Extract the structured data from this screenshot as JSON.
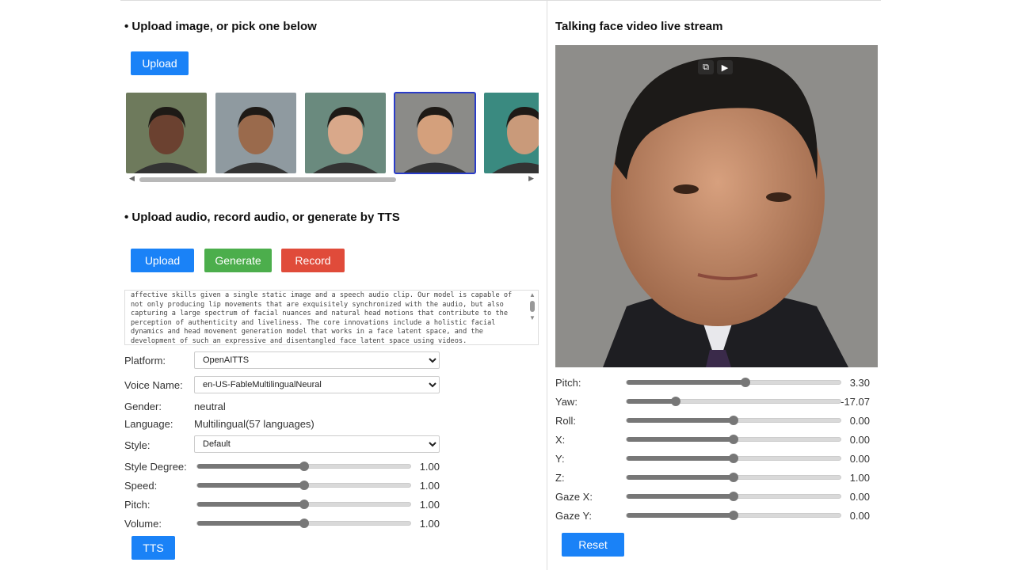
{
  "left": {
    "image_section_title": "• Upload image, or pick one below",
    "upload_image_label": "Upload",
    "thumbnails": [
      {
        "selected": false,
        "skin": "#6b4130",
        "bg": "#6e7a5c"
      },
      {
        "selected": false,
        "skin": "#9a6a4c",
        "bg": "#8f9aa0"
      },
      {
        "selected": false,
        "skin": "#d9a88a",
        "bg": "#6a8a7e"
      },
      {
        "selected": true,
        "skin": "#d4a07c",
        "bg": "#8b8b88"
      },
      {
        "selected": false,
        "skin": "#c99a7a",
        "bg": "#3a8a80"
      }
    ],
    "audio_section_title": "• Upload audio, record audio, or generate by TTS",
    "upload_audio_label": "Upload",
    "generate_label": "Generate",
    "record_label": "Record",
    "text": "affective skills given a single static image and a speech audio clip. Our model is capable of not only producing lip movements that are exquisitely synchronized with the audio, but also capturing a large spectrum of facial nuances and natural head motions that contribute to the perception of authenticity and liveliness. The core innovations include a holistic facial dynamics and head movement generation model that works in a face latent space, and the development of such an expressive and disentangled face latent space using videos.",
    "platform_label": "Platform:",
    "platform_value": "OpenAITTS",
    "voice_label": "Voice Name:",
    "voice_value": "en-US-FableMultilingualNeural",
    "gender_label": "Gender:",
    "gender_value": "neutral",
    "language_label": "Language:",
    "language_value": "Multilingual(57 languages)",
    "style_label": "Style:",
    "style_value": "Default",
    "sliders": [
      {
        "label": "Style Degree:",
        "value": "1.00",
        "fraction": 0.5
      },
      {
        "label": "Speed:",
        "value": "1.00",
        "fraction": 0.5
      },
      {
        "label": "Pitch:",
        "value": "1.00",
        "fraction": 0.5
      },
      {
        "label": "Volume:",
        "value": "1.00",
        "fraction": 0.5
      }
    ],
    "tts_label": "TTS"
  },
  "right": {
    "title": "Talking face video live stream",
    "sliders": [
      {
        "label": "Pitch:",
        "value": "3.30",
        "fraction": 0.555
      },
      {
        "label": "Yaw:",
        "value": "-17.07",
        "fraction": 0.228
      },
      {
        "label": "Roll:",
        "value": "0.00",
        "fraction": 0.5
      },
      {
        "label": "X:",
        "value": "0.00",
        "fraction": 0.5
      },
      {
        "label": "Y:",
        "value": "0.00",
        "fraction": 0.5
      },
      {
        "label": "Z:",
        "value": "1.00",
        "fraction": 0.5
      },
      {
        "label": "Gaze X:",
        "value": "0.00",
        "fraction": 0.5
      },
      {
        "label": "Gaze Y:",
        "value": "0.00",
        "fraction": 0.5
      }
    ],
    "reset_label": "Reset"
  },
  "colors": {
    "primary": "#1a82f7",
    "success": "#4cae4c",
    "danger": "#e04b3a"
  }
}
